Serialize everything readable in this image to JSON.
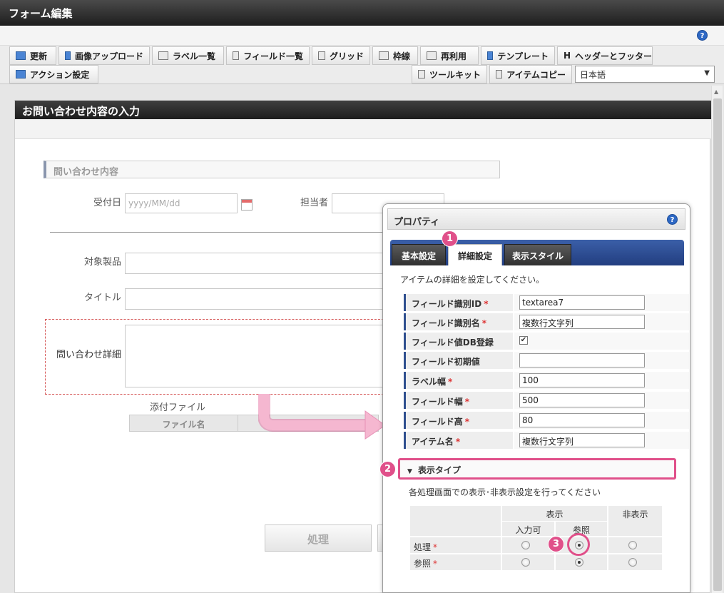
{
  "window": {
    "title": "フォーム編集"
  },
  "toolbar": {
    "row1": [
      {
        "label": "更新",
        "icon": "refresh-icon"
      },
      {
        "label": "画像アップロード",
        "icon": "image-upload-icon"
      },
      {
        "label": "ラベル一覧",
        "icon": "label-list-icon"
      },
      {
        "label": "フィールド一覧",
        "icon": "field-list-icon"
      },
      {
        "label": "グリッド",
        "icon": "grid-icon"
      },
      {
        "label": "枠線",
        "icon": "border-icon"
      },
      {
        "label": "再利用",
        "icon": "reuse-icon"
      },
      {
        "label": "テンプレート",
        "icon": "template-icon"
      },
      {
        "label": "ヘッダーとフッター",
        "icon": "header-footer-icon"
      }
    ],
    "action_label": "アクション設定",
    "toolkit_label": "ツールキット",
    "item_copy_label": "アイテムコピー",
    "language": "日本語",
    "help": "?"
  },
  "form": {
    "title": "お問い合わせ内容の入力",
    "section": "問い合わせ内容",
    "receipt_date_label": "受付日",
    "receipt_date_placeholder": "yyyy/MM/dd",
    "person_label": "担当者",
    "product_label": "対象製品",
    "title_label": "タイトル",
    "detail_label": "問い合わせ詳細",
    "attachment_label": "添付ファイル",
    "file_name_col": "ファイル名",
    "process_button": "処理"
  },
  "panel": {
    "title": "プロパティ",
    "help": "?",
    "tabs": [
      "基本設定",
      "詳細設定",
      "表示スタイル"
    ],
    "description": "アイテムの詳細を設定してください。",
    "rows": [
      {
        "label": "フィールド識別ID",
        "required": true,
        "value": "textarea7"
      },
      {
        "label": "フィールド識別名",
        "required": true,
        "value": "複数行文字列"
      },
      {
        "label": "フィールド値DB登録",
        "required": false,
        "checked": true
      },
      {
        "label": "フィールド初期値",
        "required": false,
        "value": ""
      },
      {
        "label": "ラベル幅",
        "required": true,
        "value": "100"
      },
      {
        "label": "フィールド幅",
        "required": true,
        "value": "500"
      },
      {
        "label": "フィールド高",
        "required": true,
        "value": "80"
      },
      {
        "label": "アイテム名",
        "required": true,
        "value": "複数行文字列"
      }
    ],
    "required_mark": "*",
    "display_type": {
      "header": "表示タイプ",
      "description": "各処理画面での表示･非表示設定を行ってください",
      "col_show": "表示",
      "col_hide": "非表示",
      "col_input": "入力可",
      "col_ref": "参照",
      "row_process": "処理",
      "row_reference": "参照"
    }
  },
  "badges": [
    "1",
    "2",
    "3"
  ],
  "colors": {
    "accent": "#e0508a",
    "tab_blue": "#2f4f8f"
  }
}
